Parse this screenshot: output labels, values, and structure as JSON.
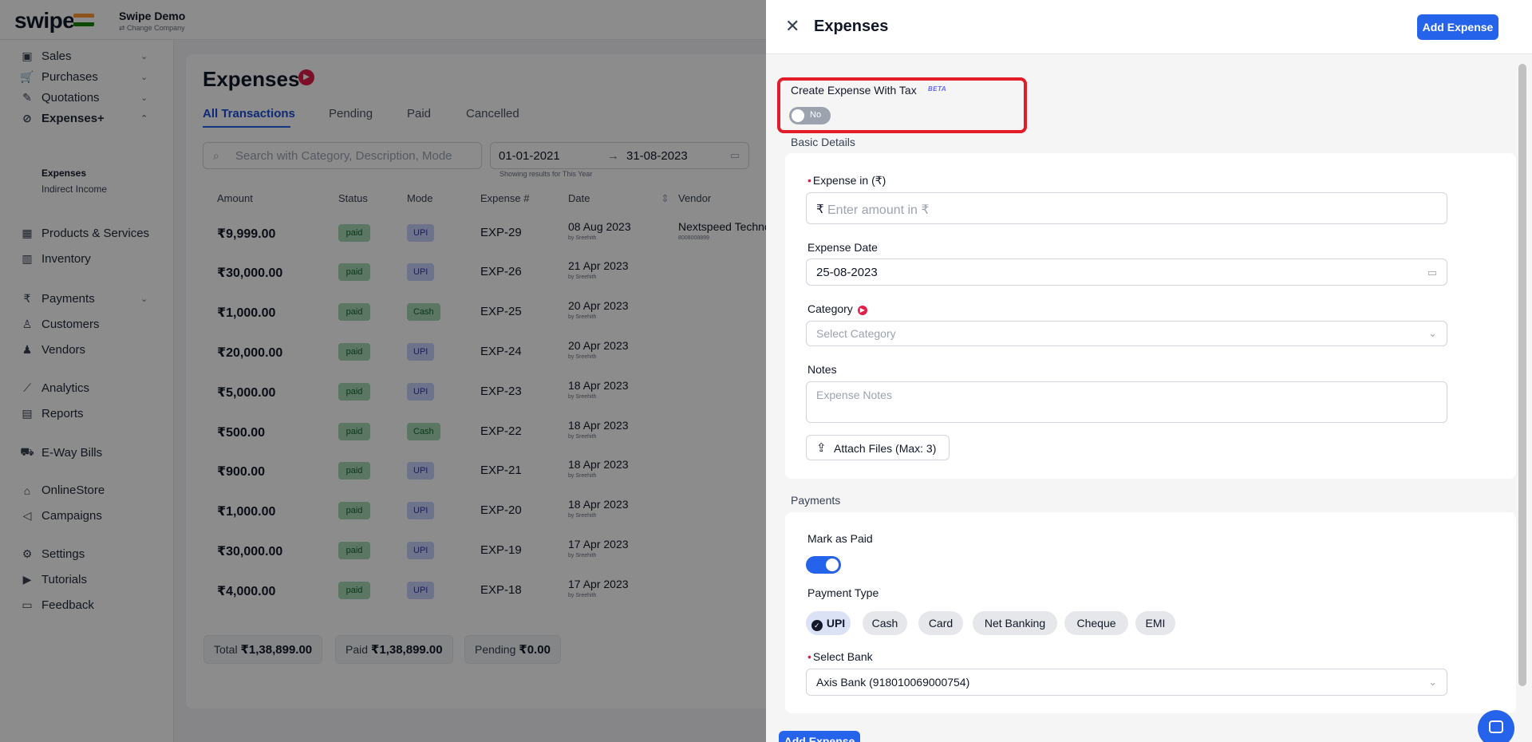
{
  "app": {
    "logo": "swipe",
    "company_name": "Swipe Demo",
    "company_sub": "⇄ Change Company"
  },
  "sidebar": {
    "items": [
      {
        "label": "Sales",
        "icon": "cash-icon"
      },
      {
        "label": "Purchases",
        "icon": "cart-icon"
      },
      {
        "label": "Quotations",
        "icon": "pen-icon"
      },
      {
        "label": "Expenses+",
        "icon": "tag-icon"
      },
      {
        "label": "Products & Services",
        "icon": "box-icon"
      },
      {
        "label": "Inventory",
        "icon": "warehouse-icon"
      },
      {
        "label": "Payments",
        "icon": "rupee-icon"
      },
      {
        "label": "Customers",
        "icon": "user-icon"
      },
      {
        "label": "Vendors",
        "icon": "users-icon"
      },
      {
        "label": "Analytics",
        "icon": "chart-icon"
      },
      {
        "label": "Reports",
        "icon": "report-icon"
      },
      {
        "label": "E-Way Bills",
        "icon": "truck-icon"
      },
      {
        "label": "OnlineStore",
        "icon": "store-icon"
      },
      {
        "label": "Campaigns",
        "icon": "megaphone-icon"
      },
      {
        "label": "Settings",
        "icon": "gear-icon"
      },
      {
        "label": "Tutorials",
        "icon": "youtube-icon"
      },
      {
        "label": "Feedback",
        "icon": "message-icon"
      }
    ],
    "sub_items": [
      "Expenses",
      "Indirect Income"
    ]
  },
  "main": {
    "title": "Expenses",
    "tabs": [
      "All Transactions",
      "Pending",
      "Paid",
      "Cancelled"
    ],
    "search_placeholder": "Search with Category, Description, Mode",
    "date_from": "01-01-2021",
    "date_sep": "→",
    "date_to": "31-08-2023",
    "showing": "Showing results for This Year",
    "columns": [
      "Amount",
      "Status",
      "Mode",
      "Expense #",
      "Date",
      "Vendor"
    ],
    "rows": [
      {
        "amount": "₹9,999.00",
        "status": "paid",
        "mode": "UPI",
        "exp": "EXP-29",
        "date": "08 Aug 2023",
        "by": "by Sreehith",
        "vendor": "Nextspeed Techno",
        "vendor_num": "8008008899"
      },
      {
        "amount": "₹30,000.00",
        "status": "paid",
        "mode": "UPI",
        "exp": "EXP-26",
        "date": "21 Apr 2023",
        "by": "by Sreehith",
        "vendor": "",
        "vendor_num": ""
      },
      {
        "amount": "₹1,000.00",
        "status": "paid",
        "mode": "Cash",
        "exp": "EXP-25",
        "date": "20 Apr 2023",
        "by": "by Sreehith",
        "vendor": "",
        "vendor_num": ""
      },
      {
        "amount": "₹20,000.00",
        "status": "paid",
        "mode": "UPI",
        "exp": "EXP-24",
        "date": "20 Apr 2023",
        "by": "by Sreehith",
        "vendor": "",
        "vendor_num": ""
      },
      {
        "amount": "₹5,000.00",
        "status": "paid",
        "mode": "UPI",
        "exp": "EXP-23",
        "date": "18 Apr 2023",
        "by": "by Sreehith",
        "vendor": "",
        "vendor_num": ""
      },
      {
        "amount": "₹500.00",
        "status": "paid",
        "mode": "Cash",
        "exp": "EXP-22",
        "date": "18 Apr 2023",
        "by": "by Sreehith",
        "vendor": "",
        "vendor_num": ""
      },
      {
        "amount": "₹900.00",
        "status": "paid",
        "mode": "UPI",
        "exp": "EXP-21",
        "date": "18 Apr 2023",
        "by": "by Sreehith",
        "vendor": "",
        "vendor_num": ""
      },
      {
        "amount": "₹1,000.00",
        "status": "paid",
        "mode": "UPI",
        "exp": "EXP-20",
        "date": "18 Apr 2023",
        "by": "by Sreehith",
        "vendor": "",
        "vendor_num": ""
      },
      {
        "amount": "₹30,000.00",
        "status": "paid",
        "mode": "UPI",
        "exp": "EXP-19",
        "date": "17 Apr 2023",
        "by": "by Sreehith",
        "vendor": "",
        "vendor_num": ""
      },
      {
        "amount": "₹4,000.00",
        "status": "paid",
        "mode": "UPI",
        "exp": "EXP-18",
        "date": "17 Apr 2023",
        "by": "by Sreehith",
        "vendor": "",
        "vendor_num": ""
      }
    ],
    "totals": {
      "total_label": "Total",
      "total_value": "₹1,38,899.00",
      "paid_label": "Paid",
      "paid_value": "₹1,38,899.00",
      "pending_label": "Pending",
      "pending_value": "₹0.00"
    }
  },
  "drawer": {
    "title": "Expenses",
    "add_button": "Add Expense",
    "tax_label": "Create Expense With Tax",
    "beta": "BETA",
    "tax_toggle_text": "No",
    "basic_details": "Basic Details",
    "expense_in_label": "Expense in (₹)",
    "amount_prefix": "₹",
    "amount_placeholder": "Enter amount in ₹",
    "expense_date_label": "Expense Date",
    "expense_date_value": "25-08-2023",
    "category_label": "Category",
    "category_placeholder": "Select Category",
    "notes_label": "Notes",
    "notes_placeholder": "Expense Notes",
    "attach_label": "Attach Files (Max: 3)",
    "payments_label": "Payments",
    "mark_paid_label": "Mark as Paid",
    "mark_paid": true,
    "payment_type_label": "Payment Type",
    "payment_types": [
      "UPI",
      "Cash",
      "Card",
      "Net Banking",
      "Cheque",
      "EMI"
    ],
    "selected_payment_type": "UPI",
    "select_bank_label": "Select Bank",
    "bank_value": "Axis Bank (918010069000754)",
    "bottom_button": "Add Expense"
  },
  "colors": {
    "primary": "#2563eb",
    "highlight": "#e11d2a",
    "paid_badge": "#a7d7b3",
    "upi_badge": "#c7d2fe"
  }
}
